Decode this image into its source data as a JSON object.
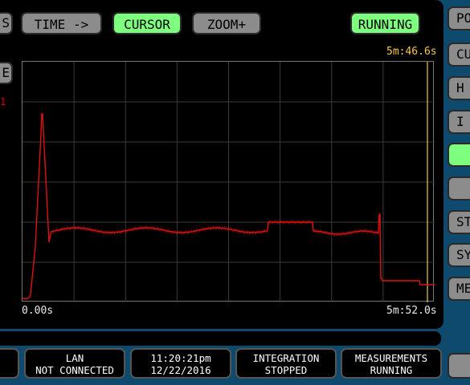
{
  "toolbar": {
    "left_stub_label": "S",
    "time_label": "TIME ->",
    "cursor_label": "CURSOR",
    "zoom_label": "ZOOM+",
    "running_label": "RUNNING"
  },
  "left_panel": {
    "stub_label": "E",
    "marker": "1"
  },
  "plot": {
    "cursor_time": "5m:46.6s",
    "x_start": "0.00s",
    "x_end": "5m:52.0s",
    "trace_color": "#e01010",
    "cursor_color": "#f5c84a"
  },
  "side_buttons": [
    "PO",
    "CU",
    "H",
    "I",
    "",
    "",
    "ST",
    "SY",
    "ME"
  ],
  "status": {
    "lan_line1": "LAN",
    "lan_line2": "NOT CONNECTED",
    "time_line1": "11:20:21pm",
    "time_line2": "12/22/2016",
    "integration_line1": "INTEGRATION",
    "integration_line2": "STOPPED",
    "measurements_line1": "MEASUREMENTS",
    "measurements_line2": "RUNNING"
  }
}
